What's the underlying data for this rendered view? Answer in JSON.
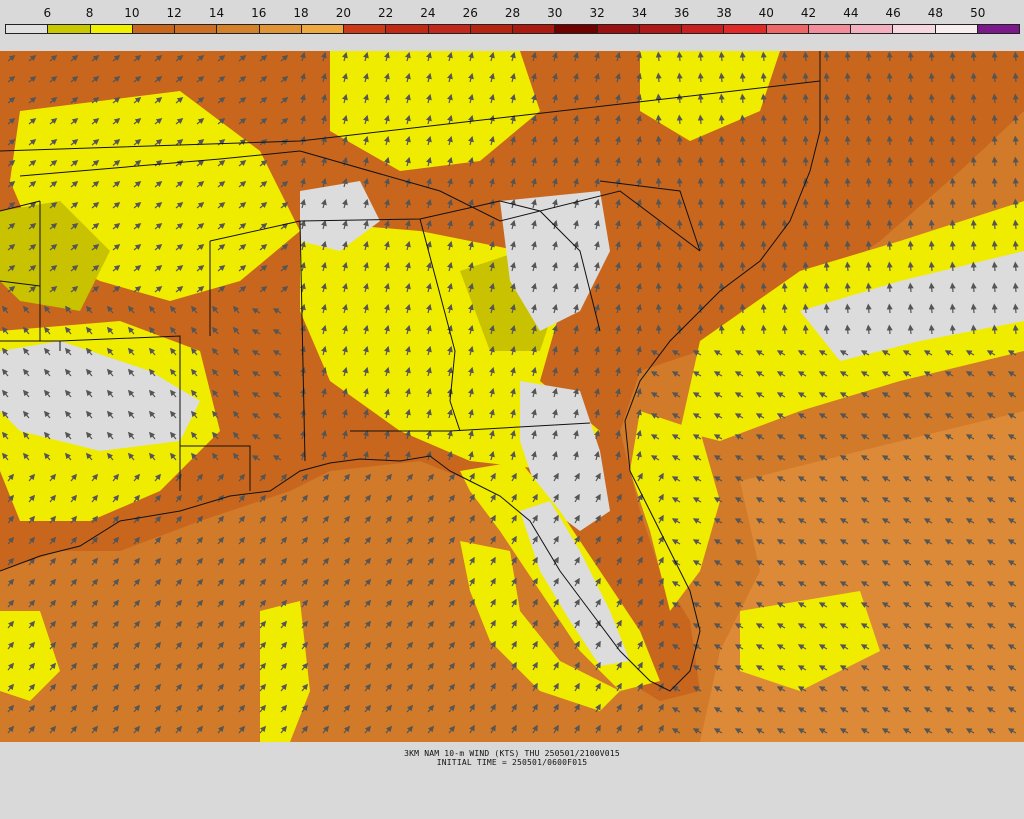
{
  "colorbar": {
    "labels": [
      "6",
      "8",
      "10",
      "12",
      "14",
      "16",
      "18",
      "20",
      "22",
      "24",
      "26",
      "28",
      "30",
      "32",
      "34",
      "36",
      "38",
      "40",
      "42",
      "44",
      "46",
      "48",
      "50"
    ],
    "colors": [
      "#e0e0e0",
      "#c8c800",
      "#f0f000",
      "#c8661e",
      "#cc6e24",
      "#d4822a",
      "#e09436",
      "#eeaa40",
      "#cc3a1a",
      "#c02a14",
      "#c0281e",
      "#b42410",
      "#aa1a10",
      "#6e0000",
      "#9a0f0f",
      "#b01818",
      "#c82020",
      "#e02a2a",
      "#ee6666",
      "#f28c9a",
      "#f4b0be",
      "#f8d8e0",
      "#f8eef0",
      "#7a1a8a"
    ]
  },
  "map": {
    "colors": {
      "ocean_orange": "#d07a2a",
      "land_orange": "#c8661e",
      "yellow": "#f0ec00",
      "olive": "#c8c200",
      "gray": "#dcdcdc",
      "arrow": "#555555",
      "border": "#111111"
    }
  },
  "caption": {
    "line1": "3KM NAM 10-m WIND (KTS) THU 250501/2100V015",
    "line2": "INITIAL TIME = 250501/0600F015"
  }
}
